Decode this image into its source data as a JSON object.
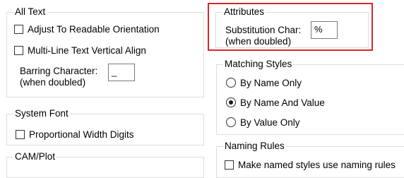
{
  "all_text": {
    "title": "All Text",
    "adjust_label": "Adjust To Readable Orientation",
    "multiline_label": "Multi-Line Text Vertical Align",
    "barring_label_line1": "Barring Character:",
    "barring_label_line2": "(when doubled)",
    "barring_value": "_"
  },
  "system_font": {
    "title": "System Font",
    "proportional_label": "Proportional Width Digits"
  },
  "cam_plot": {
    "title": "CAM/Plot"
  },
  "attributes": {
    "title": "Attributes",
    "substitution_label_line1": "Substitution Char:",
    "substitution_label_line2": "(when doubled)",
    "substitution_value": "%"
  },
  "matching_styles": {
    "title": "Matching Styles",
    "options": [
      {
        "label": "By Name Only",
        "checked": false
      },
      {
        "label": "By Name And Value",
        "checked": true
      },
      {
        "label": "By Value Only",
        "checked": false
      }
    ]
  },
  "naming_rules": {
    "title": "Naming Rules",
    "make_named_label": "Make named styles use naming rules"
  },
  "highlight_color": "#d9262b"
}
